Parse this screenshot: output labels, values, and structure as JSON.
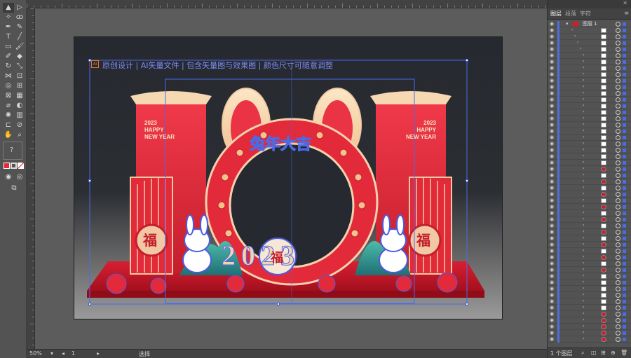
{
  "panel": {
    "tabs": [
      "图层",
      "段落",
      "字符"
    ],
    "top_layer_name": "图层 1",
    "footer_count": "1 个图层",
    "rows_count": 50
  },
  "statusbar": {
    "zoom": "50%",
    "page": "1",
    "tool_name": "选择"
  },
  "artwork": {
    "headline": "原创设计 | AI矢量文件 | 包含矢量图与效果图 | 颜色尺寸可随意调整",
    "ai_badge": "Ai",
    "left_banner": [
      "2023",
      "HAPPY",
      "NEW YEAR"
    ],
    "right_banner": [
      "2023",
      "HAPPY",
      "NEW YEAR"
    ],
    "title": "兔年大吉",
    "fu": "福",
    "year": "2023"
  },
  "colors": {
    "red": "#e8283a",
    "deep_red": "#c41f2d",
    "cream": "#f8d9b5",
    "selection": "#4a6be8"
  }
}
